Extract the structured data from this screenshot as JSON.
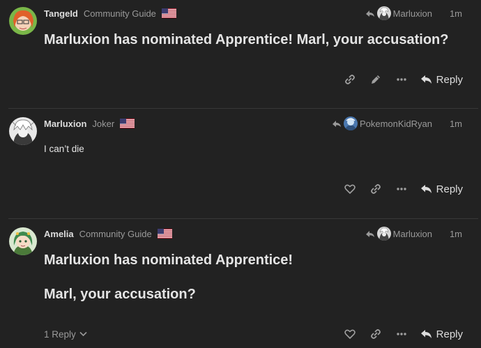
{
  "posts": [
    {
      "username": "TangeId",
      "user_title": "Community Guide",
      "flag_icon": "us-flag-icon",
      "reply_to_user": "Marluxion",
      "time": "1m",
      "content_lines": [
        "Marluxion has nominated Apprentice! Marl, your accusation?"
      ],
      "actions": [
        "link-icon",
        "edit-icon",
        "more-icon"
      ],
      "reply_label": "Reply"
    },
    {
      "username": "Marluxion",
      "user_title": "Joker",
      "flag_icon": "us-flag-icon",
      "reply_to_user": "PokemonKidRyan",
      "time": "1m",
      "content_lines": [
        "I can’t die"
      ],
      "actions": [
        "heart-icon",
        "link-icon",
        "more-icon"
      ],
      "reply_label": "Reply"
    },
    {
      "username": "Amelia",
      "user_title": "Community Guide",
      "flag_icon": "us-flag-icon",
      "reply_to_user": "Marluxion",
      "time": "1m",
      "content_lines": [
        "Marluxion has nominated Apprentice!",
        "Marl, your accusation?"
      ],
      "actions": [
        "heart-icon",
        "link-icon",
        "more-icon"
      ],
      "reply_label": "Reply",
      "replies_count_label": "1 Reply"
    }
  ],
  "colors": {
    "background": "#222222",
    "text": "#dddddd",
    "muted": "#9a9a9a",
    "divider": "#383838"
  }
}
